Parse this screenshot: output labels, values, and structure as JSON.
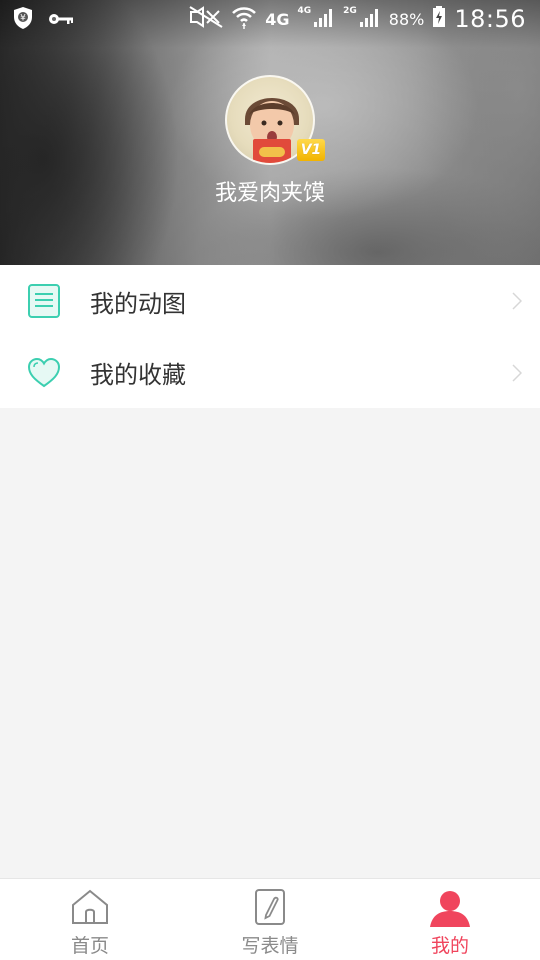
{
  "status_bar": {
    "network_1": "4G",
    "network_2_small": "4G",
    "network_3_small": "2G",
    "battery_percent": "88%",
    "time": "18:56"
  },
  "profile": {
    "username": "我爱肉夹馍",
    "vip_level": "V1"
  },
  "menu": {
    "items": [
      {
        "label": "我的动图",
        "icon": "document-list-icon"
      },
      {
        "label": "我的收藏",
        "icon": "heart-icon"
      }
    ]
  },
  "bottom_nav": {
    "items": [
      {
        "label": "首页",
        "icon": "home-icon",
        "active": false
      },
      {
        "label": "写表情",
        "icon": "pencil-note-icon",
        "active": false
      },
      {
        "label": "我的",
        "icon": "user-icon",
        "active": true
      }
    ]
  },
  "colors": {
    "accent": "#f0455d",
    "icon_teal": "#3ccfb0",
    "background": "#f4f4f4"
  }
}
